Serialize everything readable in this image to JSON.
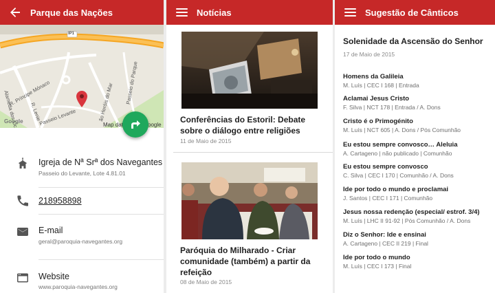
{
  "colors": {
    "appbar": "#c62828",
    "fab": "#1fa85c",
    "pin": "#d9363e"
  },
  "screen1": {
    "title": "Parque das Nações",
    "map": {
      "road_badge": "IP1",
      "streets": [
        "R. Príncipe Mónaco",
        "Alameda dos Oc",
        "R. Lenie",
        "Passeio Levante",
        "Passeio do Parque",
        "ão Heróis do Mar"
      ],
      "corner_left": "Google",
      "corner_right": "Map dat",
      "corner_right2": "oogle"
    },
    "items": [
      {
        "icon": "church-icon",
        "main": "Igreja de Nª Srª dos Navegantes",
        "sub": "Passeio do Levante, Lote 4.81.01"
      },
      {
        "icon": "phone-icon",
        "main": "218958898",
        "sub": ""
      },
      {
        "icon": "email-icon",
        "main": "E-mail",
        "sub": "geral@paroquia-navegantes.org"
      },
      {
        "icon": "web-icon",
        "main": "Website",
        "sub": "www.paroquia-navegantes.org"
      }
    ]
  },
  "screen2": {
    "title": "Notícias",
    "articles": [
      {
        "title": "Conferências do Estoril: Debate sobre o diálogo entre religiões",
        "date": "11 de Maio de 2015"
      },
      {
        "title": "Paróquia do Milharado - Criar comunidade (também) a partir da refeição",
        "date": "08 de Maio de 2015"
      }
    ]
  },
  "screen3": {
    "title": "Sugestão de Cânticos",
    "heading": "Solenidade da Ascensão do Senhor",
    "date": "17 de Maio de 2015",
    "songs": [
      {
        "name": "Homens da Galileia",
        "meta": "M. Luís | CEC I 168 | Entrada"
      },
      {
        "name": "Aclamai Jesus Cristo",
        "meta": "F. Silva | NCT 178 | Entrada / A. Dons"
      },
      {
        "name": "Cristo é o Primogénito",
        "meta": "M. Luís | NCT 605 | A. Dons / Pós Comunhão"
      },
      {
        "name": "Eu estou sempre convosco… Aleluia",
        "meta": "A. Cartageno | não publicado | Comunhão"
      },
      {
        "name": "Eu estou sempre convosco",
        "meta": "C. Silva | CEC I 170 | Comunhão / A. Dons"
      },
      {
        "name": "Ide por todo o mundo e proclamai",
        "meta": "J. Santos | CEC I 171 | Comunhão"
      },
      {
        "name": "Jesus nossa redenção (especial/ estrof. 3/4)",
        "meta": "M. Luís | LHC II 91-92 | Pós Comunhão / A. Dons"
      },
      {
        "name": "Diz o Senhor: Ide e ensinai",
        "meta": "A. Cartageno | CEC II 219 | Final"
      },
      {
        "name": "Ide por todo o mundo",
        "meta": "M. Luís | CEC I 173 | Final"
      }
    ]
  }
}
